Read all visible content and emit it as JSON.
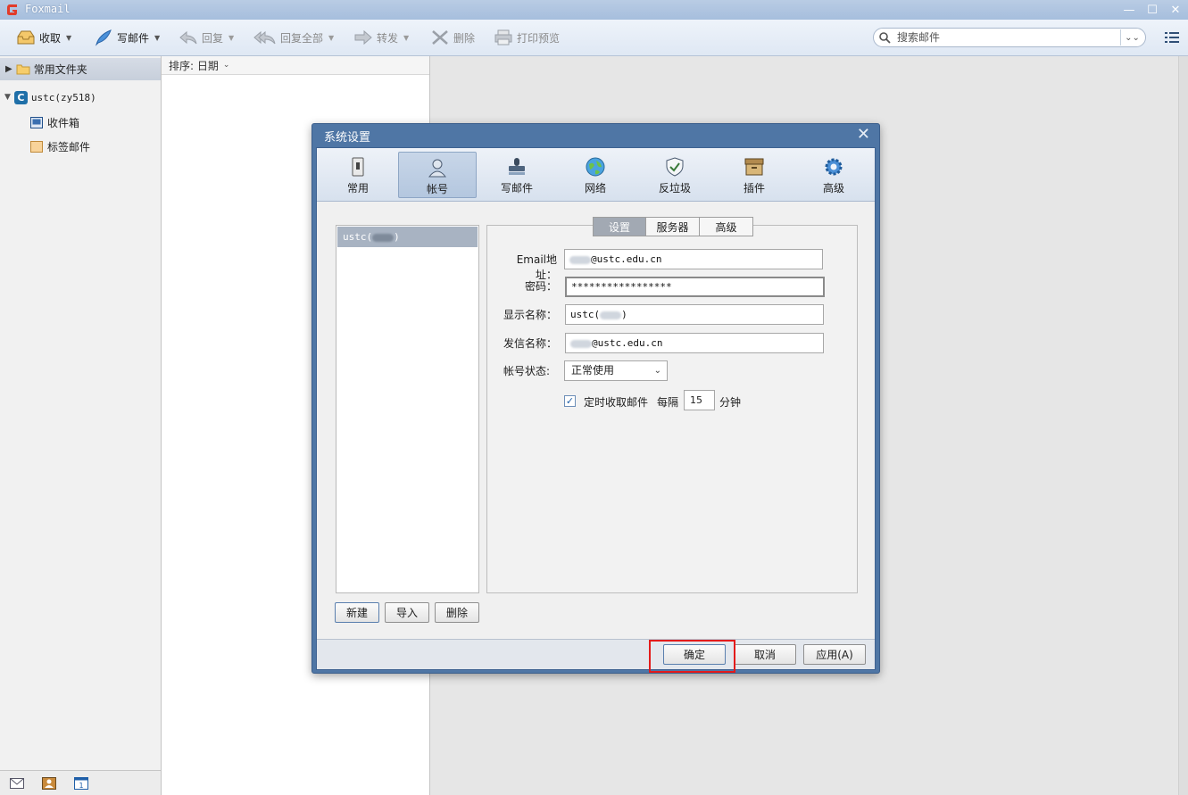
{
  "window": {
    "title": "Foxmail"
  },
  "toolbar": {
    "receive": "收取",
    "compose": "写邮件",
    "reply": "回复",
    "reply_all": "回复全部",
    "forward": "转发",
    "delete": "删除",
    "print_preview": "打印预览"
  },
  "search": {
    "placeholder": "搜索邮件"
  },
  "sidebar": {
    "favorites": "常用文件夹",
    "account": "ustc(zy518)",
    "items": [
      {
        "label": "收件箱"
      },
      {
        "label": "标签邮件"
      }
    ]
  },
  "maillist": {
    "sort_label": "排序: 日期"
  },
  "dialog": {
    "title": "系统设置",
    "categories": [
      {
        "label": "常用"
      },
      {
        "label": "帐号"
      },
      {
        "label": "写邮件"
      },
      {
        "label": "网络"
      },
      {
        "label": "反垃圾"
      },
      {
        "label": "插件"
      },
      {
        "label": "高级"
      }
    ],
    "account_list_item": "ustc(",
    "account_list_item_end": ")",
    "tabs": [
      "设置",
      "服务器",
      "高级"
    ],
    "form": {
      "email_label": "Email地址：",
      "email_value": "@ustc.edu.cn",
      "password_label": "密码：",
      "password_value": "*****************",
      "display_name_label": "显示名称：",
      "display_name_prefix": "ustc(",
      "display_name_suffix": ")",
      "sender_name_label": "发信名称：",
      "sender_name_value": "@ustc.edu.cn",
      "status_label": "帐号状态:",
      "status_value": "正常使用",
      "auto_fetch_label": "定时收取邮件",
      "interval_label": "每隔",
      "interval_value": "15",
      "interval_unit": "分钟"
    },
    "buttons": {
      "new": "新建",
      "import": "导入",
      "delete": "删除",
      "ok": "确定",
      "cancel": "取消",
      "apply": "应用(A)"
    }
  },
  "colors": {
    "dialog_frame": "#4f76a5",
    "highlight": "#e31b1b",
    "selected_tab": "#a2a9b3"
  }
}
